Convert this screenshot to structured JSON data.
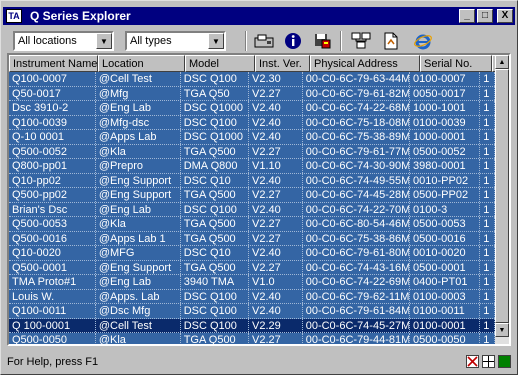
{
  "window": {
    "title": "Q Series Explorer",
    "app_icon": "TA"
  },
  "title_buttons": {
    "minimize": "_",
    "maximize": "□",
    "close": "X"
  },
  "toolbar": {
    "location_filter": "All locations",
    "type_filter": "All types",
    "tools": [
      "instrument-icon",
      "info-icon",
      "save-icon",
      "network-icon",
      "document-icon",
      "internet-explorer-icon"
    ]
  },
  "table": {
    "columns": [
      "Instrument Name",
      "Location",
      "Model",
      "Inst. Ver.",
      "Physical Address",
      "Serial No.",
      "I"
    ],
    "rows": [
      [
        "Q100-0007",
        "@Cell Test",
        "DSC Q100",
        "V2.30",
        "00-C0-6C-79-63-44M",
        "0100-0007",
        "1"
      ],
      [
        "Q50-0017",
        "@Mfg",
        "TGA Q50",
        "V2.27",
        "00-C0-6C-79-61-82M",
        "0050-0017",
        "1"
      ],
      [
        "Dsc 3910-2",
        "@Eng Lab",
        "DSC Q1000",
        "V2.40",
        "00-C0-6C-74-22-68M",
        "1000-1001",
        "1"
      ],
      [
        "Q100-0039",
        "@Mfg-dsc",
        "DSC Q100",
        "V2.40",
        "00-C0-6C-75-18-08M",
        "0100-0039",
        "1"
      ],
      [
        "Q-10 0001",
        "@Apps Lab",
        "DSC Q1000",
        "V2.40",
        "00-C0-6C-75-38-89M",
        "1000-0001",
        "1"
      ],
      [
        "Q500-0052",
        "@Kla",
        "TGA Q500",
        "V2.27",
        "00-C0-6C-79-61-77M",
        "0500-0052",
        "1"
      ],
      [
        "Q800-pp01",
        "@Prepro",
        "DMA Q800",
        "V1.10",
        "00-C0-6C-74-30-90M",
        "3980-0001",
        "1"
      ],
      [
        "Q10-pp02",
        "@Eng Support",
        "DSC Q10",
        "V2.40",
        "00-C0-6C-74-49-55M",
        "0010-PP02",
        "1"
      ],
      [
        "Q500-pp02",
        "@Eng Support",
        "TGA Q500",
        "V2.27",
        "00-C0-6C-74-45-28M",
        "0500-PP02",
        "1"
      ],
      [
        "Brian's Dsc",
        "@Eng Lab",
        "DSC Q100",
        "V2.40",
        "00-C0-6C-74-22-70M",
        "0100-3",
        "1"
      ],
      [
        "Q500-0053",
        "@Kla",
        "TGA Q500",
        "V2.27",
        "00-C0-6C-80-54-46M",
        "0500-0053",
        "1"
      ],
      [
        "Q500-0016",
        "@Apps Lab 1",
        "TGA Q500",
        "V2.27",
        "00-C0-6C-75-38-86M",
        "0500-0016",
        "1"
      ],
      [
        "Q10-0020",
        "@MFG",
        "DSC Q10",
        "V2.40",
        "00-C0-6C-79-61-80M",
        "0010-0020",
        "1"
      ],
      [
        "Q500-0001",
        "@Eng Support",
        "TGA Q500",
        "V2.27",
        "00-C0-6C-74-43-16M",
        "0500-0001",
        "1"
      ],
      [
        "TMA Proto#1",
        "@Eng Lab",
        "3940 TMA",
        "V1.0",
        "00-C0-6C-74-22-69M",
        "0400-PT01",
        "1"
      ],
      [
        "Louis W.",
        "@Apps. Lab",
        "DSC Q100",
        "V2.40",
        "00-C0-6C-79-62-11M",
        "0100-0003",
        "1"
      ],
      [
        "Q100-0011",
        "@Dsc Mfg",
        "DSC Q100",
        "V2.40",
        "00-C0-6C-79-61-84M",
        "0100-0011",
        "1"
      ],
      [
        "Q 100-0001",
        "@Cell Test",
        "DSC Q100",
        "V2.29",
        "00-C0-6C-74-45-27M",
        "0100-0001",
        "1"
      ],
      [
        "Q500-0050",
        "@Kla",
        "TGA Q500",
        "V2.27",
        "00-C0-6C-79-44-81M",
        "0500-0050",
        "1"
      ]
    ]
  },
  "scrollbar": {
    "up": "▲",
    "down": "▼"
  },
  "status": {
    "text": "For Help, press F1",
    "icons": [
      "disconnect-icon",
      "grid-icon",
      "connected-icon"
    ]
  },
  "colors": {
    "title_bar": "#000080",
    "row_selected": "#3465a4",
    "row_focus": "#0a2a6b",
    "window_face": "#c0c0c0"
  }
}
